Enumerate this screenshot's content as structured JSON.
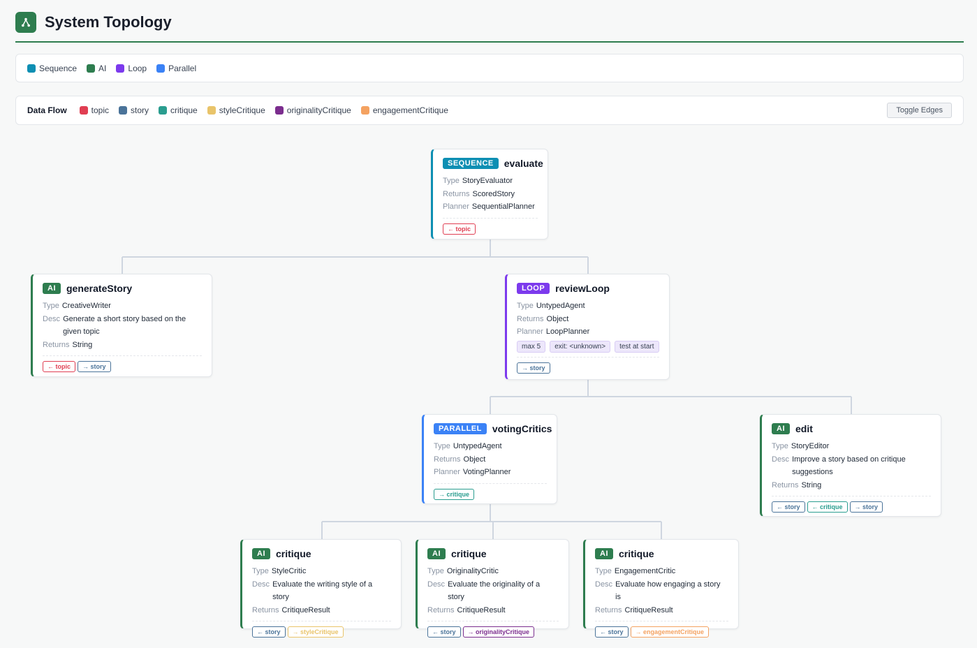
{
  "header": {
    "title": "System Topology",
    "icon": "fork-icon"
  },
  "legend": [
    {
      "label": "Sequence",
      "color": "#0e8fb3"
    },
    {
      "label": "AI",
      "color": "#2e7d4f"
    },
    {
      "label": "Loop",
      "color": "#7c3aed"
    },
    {
      "label": "Parallel",
      "color": "#3b82f6"
    }
  ],
  "data_flow": {
    "title": "Data Flow",
    "toggle_label": "Toggle Edges",
    "items": [
      {
        "label": "topic",
        "color": "#e03e52"
      },
      {
        "label": "story",
        "color": "#4a7399"
      },
      {
        "label": "critique",
        "color": "#2a9d8f"
      },
      {
        "label": "styleCritique",
        "color": "#e9c46a"
      },
      {
        "label": "originalityCritique",
        "color": "#7b2d8e"
      },
      {
        "label": "engagementCritique",
        "color": "#f4a261"
      }
    ]
  },
  "nodes": {
    "evaluate": {
      "badge": "SEQUENCE",
      "name": "evaluate",
      "rows": [
        [
          "Type",
          "StoryEvaluator"
        ],
        [
          "Returns",
          "ScoredStory"
        ],
        [
          "Planner",
          "SequentialPlanner"
        ]
      ],
      "flows": [
        {
          "label": "← topic",
          "color": "#e03e52"
        }
      ]
    },
    "generateStory": {
      "badge": "AI",
      "name": "generateStory",
      "rows": [
        [
          "Type",
          "CreativeWriter"
        ],
        [
          "Desc",
          "Generate a short story based on the given topic"
        ],
        [
          "Returns",
          "String"
        ]
      ],
      "flows": [
        {
          "label": "← topic",
          "color": "#e03e52"
        },
        {
          "label": "→ story",
          "color": "#4a7399"
        }
      ]
    },
    "reviewLoop": {
      "badge": "LOOP",
      "name": "reviewLoop",
      "rows": [
        [
          "Type",
          "UntypedAgent"
        ],
        [
          "Returns",
          "Object"
        ],
        [
          "Planner",
          "LoopPlanner"
        ]
      ],
      "tags": [
        "max 5",
        "exit: <unknown>",
        "test at start"
      ],
      "flows": [
        {
          "label": "→ story",
          "color": "#4a7399"
        }
      ]
    },
    "votingCritics": {
      "badge": "PARALLEL",
      "name": "votingCritics",
      "rows": [
        [
          "Type",
          "UntypedAgent"
        ],
        [
          "Returns",
          "Object"
        ],
        [
          "Planner",
          "VotingPlanner"
        ]
      ],
      "flows": [
        {
          "label": "→ critique",
          "color": "#2a9d8f"
        }
      ]
    },
    "edit": {
      "badge": "AI",
      "name": "edit",
      "rows": [
        [
          "Type",
          "StoryEditor"
        ],
        [
          "Desc",
          "Improve a story based on critique suggestions"
        ],
        [
          "Returns",
          "String"
        ]
      ],
      "flows": [
        {
          "label": "← story",
          "color": "#4a7399"
        },
        {
          "label": "← critique",
          "color": "#2a9d8f"
        },
        {
          "label": "→ story",
          "color": "#4a7399"
        }
      ]
    },
    "critique1": {
      "badge": "AI",
      "name": "critique",
      "rows": [
        [
          "Type",
          "StyleCritic"
        ],
        [
          "Desc",
          "Evaluate the writing style of a story"
        ],
        [
          "Returns",
          "CritiqueResult"
        ]
      ],
      "flows": [
        {
          "label": "← story",
          "color": "#4a7399"
        },
        {
          "label": "→ styleCritique",
          "color": "#e9c46a"
        }
      ]
    },
    "critique2": {
      "badge": "AI",
      "name": "critique",
      "rows": [
        [
          "Type",
          "OriginalityCritic"
        ],
        [
          "Desc",
          "Evaluate the originality of a story"
        ],
        [
          "Returns",
          "CritiqueResult"
        ]
      ],
      "flows": [
        {
          "label": "← story",
          "color": "#4a7399"
        },
        {
          "label": "→ originalityCritique",
          "color": "#7b2d8e"
        }
      ]
    },
    "critique3": {
      "badge": "AI",
      "name": "critique",
      "rows": [
        [
          "Type",
          "EngagementCritic"
        ],
        [
          "Desc",
          "Evaluate how engaging a story is"
        ],
        [
          "Returns",
          "CritiqueResult"
        ]
      ],
      "flows": [
        {
          "label": "← story",
          "color": "#4a7399"
        },
        {
          "label": "→ engagementCritique",
          "color": "#f4a261"
        }
      ]
    }
  }
}
